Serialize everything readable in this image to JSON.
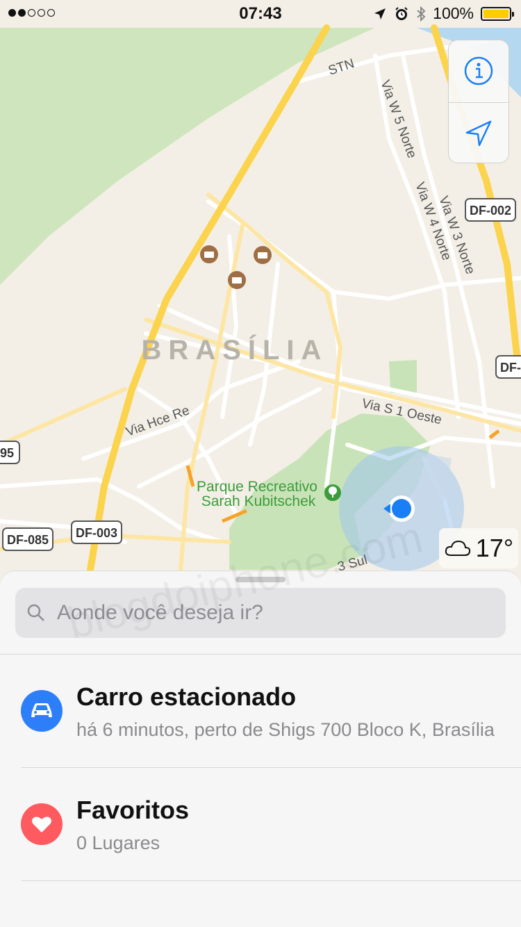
{
  "status_bar": {
    "time": "07:43",
    "battery_percent": "100%",
    "signal_bars_filled": 2,
    "signal_bars_total": 5,
    "icons": [
      "location-arrow-icon",
      "alarm-icon",
      "bluetooth-icon",
      "battery-icon"
    ]
  },
  "map": {
    "city_label": "BRASÍLIA",
    "park_label_line1": "Parque Recreativo",
    "park_label_line2": "Sarah Kubitschek",
    "street_labels": {
      "stn": "STN",
      "via_w5": "Via W 5 Norte",
      "via_w4": "Via W 4 Norte",
      "via_w3": "Via W 3 Norte",
      "via_hce": "Via Hce Re",
      "via_s1": "Via S 1 Oeste",
      "sul": "3 Sul"
    },
    "road_shields": {
      "df002": "DF-002",
      "df003": "DF-003",
      "df085": "DF-085",
      "df0_partial": "DF-0",
      "n95": "95"
    },
    "colors": {
      "land": "#f3efe6",
      "park": "#c9e3b8",
      "highway": "#fbd34d",
      "road": "#ffffff",
      "water": "#a9d3ef",
      "park_label": "#3b9c3b",
      "user_location": "#1a7ff5"
    }
  },
  "weather": {
    "icon": "cloud-icon",
    "temperature": "17°"
  },
  "controls": {
    "info_icon": "info-icon",
    "location_icon": "location-arrow-icon"
  },
  "sheet": {
    "search_placeholder": "Aonde você deseja ir?",
    "items": [
      {
        "title": "Carro estacionado",
        "subtitle": "há 6 minutos, perto de Shigs 700 Bloco K, Brasília",
        "icon": "car-icon",
        "color": "#2d7ff9"
      },
      {
        "title": "Favoritos",
        "subtitle": "0 Lugares",
        "icon": "heart-icon",
        "color": "#ff5a5f"
      }
    ]
  },
  "watermark": "blogdoiphone.com"
}
